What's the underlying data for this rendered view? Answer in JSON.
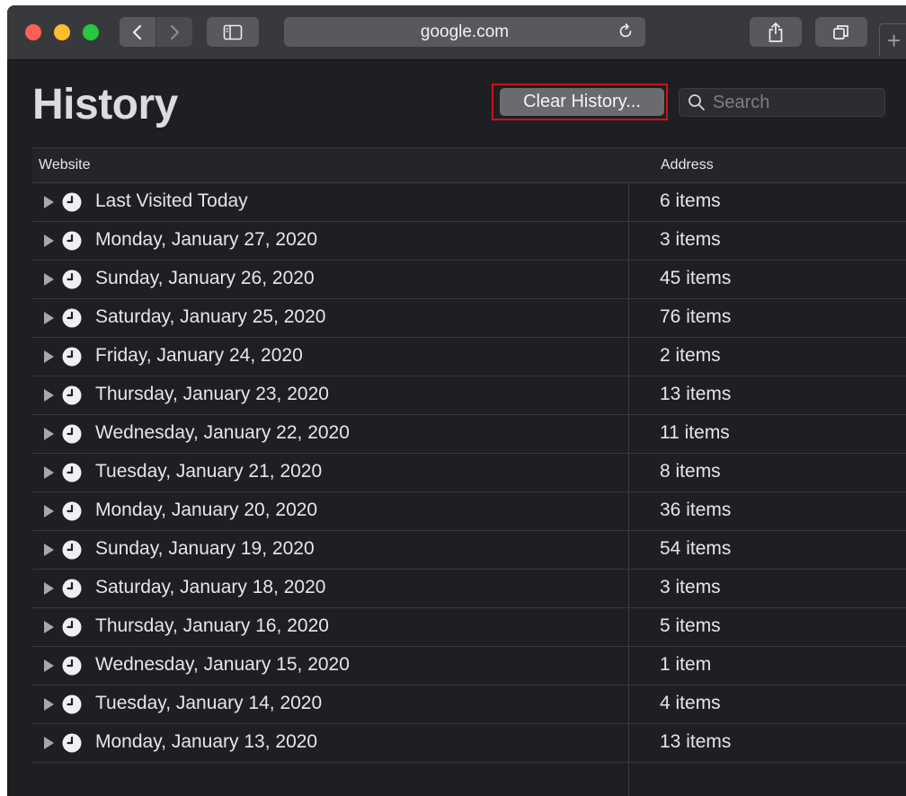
{
  "toolbar": {
    "address": "google.com",
    "icons": [
      "back-icon",
      "forward-icon",
      "sidebar-icon",
      "reload-icon",
      "share-icon",
      "tabs-overview-icon",
      "new-tab-icon"
    ],
    "new_tab": "+"
  },
  "header": {
    "title": "History",
    "clear_label": "Clear History...",
    "search_placeholder": "Search",
    "highlight_color": "#d0101c"
  },
  "table": {
    "columns": [
      "Website",
      "Address"
    ],
    "rows": [
      {
        "label": "Last Visited Today",
        "count": "6 items"
      },
      {
        "label": "Monday, January 27, 2020",
        "count": "3 items"
      },
      {
        "label": "Sunday, January 26, 2020",
        "count": "45 items"
      },
      {
        "label": "Saturday, January 25, 2020",
        "count": "76 items"
      },
      {
        "label": "Friday, January 24, 2020",
        "count": "2 items"
      },
      {
        "label": "Thursday, January 23, 2020",
        "count": "13 items"
      },
      {
        "label": "Wednesday, January 22, 2020",
        "count": "11 items"
      },
      {
        "label": "Tuesday, January 21, 2020",
        "count": "8 items"
      },
      {
        "label": "Monday, January 20, 2020",
        "count": "36 items"
      },
      {
        "label": "Sunday, January 19, 2020",
        "count": "54 items"
      },
      {
        "label": "Saturday, January 18, 2020",
        "count": "3 items"
      },
      {
        "label": "Thursday, January 16, 2020",
        "count": "5 items"
      },
      {
        "label": "Wednesday, January 15, 2020",
        "count": "1 item"
      },
      {
        "label": "Tuesday, January 14, 2020",
        "count": "4 items"
      },
      {
        "label": "Monday, January 13, 2020",
        "count": "13 items"
      }
    ]
  }
}
